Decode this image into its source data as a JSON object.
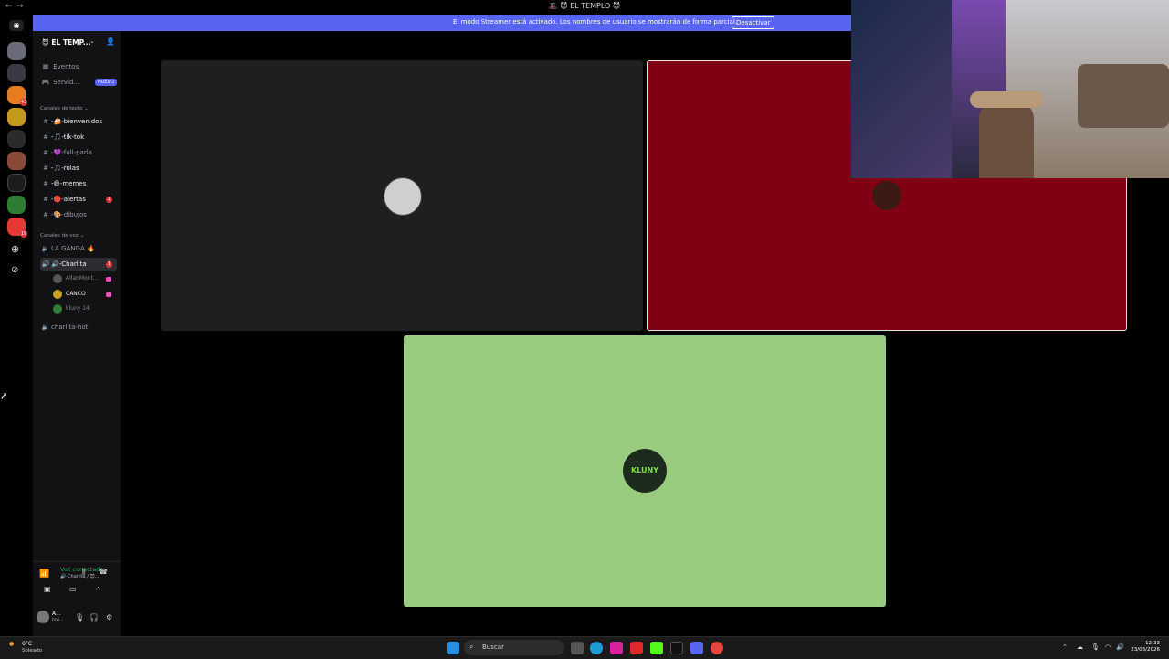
{
  "window": {
    "title": "🎩 😈 EL TEMPLO 😈"
  },
  "banner": {
    "message": "El modo Streamer está activado. Los nombres de usuario se mostrarán de forma parcial.",
    "button": "Desactivar"
  },
  "guild_badges": [
    "",
    "",
    "43",
    "",
    "",
    "",
    "",
    "",
    "19"
  ],
  "server": {
    "name": "😈 EL TEMP..."
  },
  "top_items": [
    {
      "label": "Eventos",
      "icon": "calendar-icon"
    },
    {
      "label": "Servid...",
      "icon": "gamepad-icon",
      "badge": "NUEVO"
    }
  ],
  "text_category": "Canales de texto ⌄",
  "text_channels": [
    {
      "label": "-🍰-bienvenidos",
      "bright": true
    },
    {
      "label": "-🎵-tik-tok",
      "bright": true
    },
    {
      "label": "-💜-full-parla",
      "bright": false
    },
    {
      "label": "-🎵-rolas",
      "bright": true
    },
    {
      "label": "-😄-memes",
      "bright": true
    },
    {
      "label": "-🔴-alertas",
      "bright": true,
      "mentions": "1"
    },
    {
      "label": "-🎨-dibujos",
      "bright": false
    }
  ],
  "voice_category": "Canales de voz ⌄",
  "voice_channels": [
    {
      "label": "LA GANGA 🔥",
      "bright": false
    },
    {
      "label": "🔊-Charlita",
      "bright": true,
      "mentions": "1"
    }
  ],
  "voice_users": [
    {
      "name": "AllanMont...",
      "live": true
    },
    {
      "name": "CANCO",
      "live": true
    },
    {
      "name": "kluny 14",
      "live": false
    }
  ],
  "extra_channel": {
    "label": "charlita-hot"
  },
  "voice_status": {
    "title": "Voz conectada",
    "subtitle": "🔊-Charlita / 😈..."
  },
  "user": {
    "name": "A...",
    "status": "Invi..."
  },
  "tiles": [
    {
      "name": "tile-allan",
      "color": "#1f1f22"
    },
    {
      "name": "tile-canco",
      "color": "#800014"
    },
    {
      "name": "tile-kluny",
      "color": "#99cc7f",
      "avatar_text": "KLUNY"
    }
  ],
  "taskbar": {
    "weather_temp": "6°C",
    "weather_desc": "Soleado",
    "search_label": "Buscar",
    "time": "12:33",
    "date": "23/03/2026"
  }
}
